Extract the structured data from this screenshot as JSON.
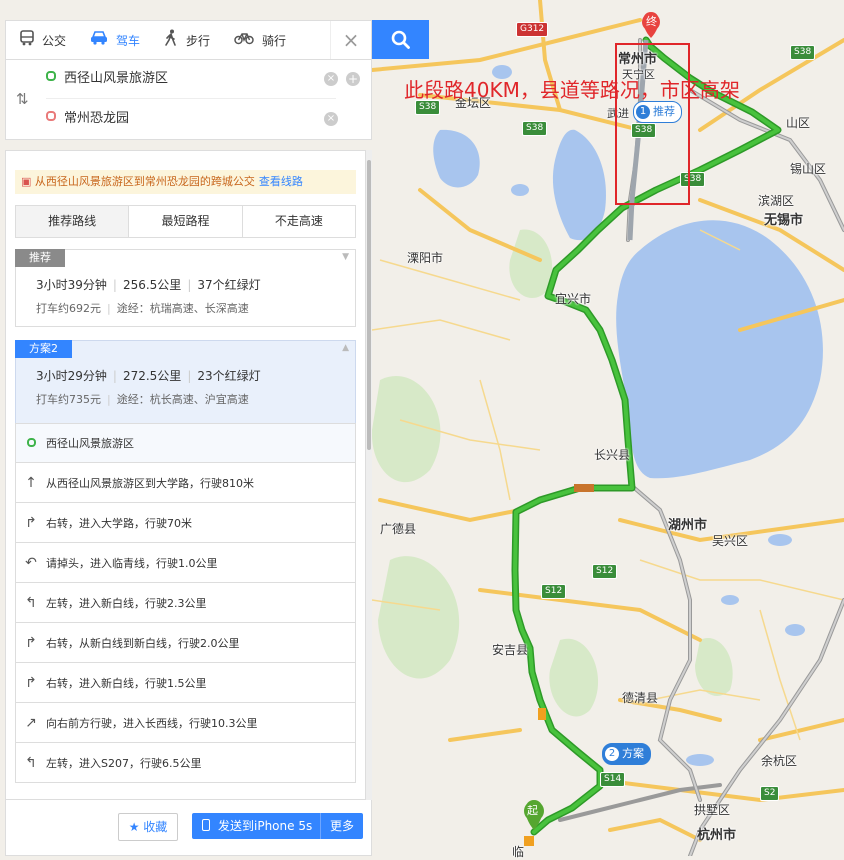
{
  "map": {
    "annotation": "此段路40KM，县道等路况，市区高架",
    "places": {
      "changzhou": "常州市",
      "tianning": "天宁区",
      "wujin": "武进",
      "jintan": "金坛区",
      "liyang": "溧阳市",
      "yixing": "宜兴市",
      "wuxi": "无锡市",
      "binhu": "滨湖区",
      "xishan": "锡山区",
      "changxing": "长兴县",
      "huzhou": "湖州市",
      "wuxing": "吴兴区",
      "guangde": "广德县",
      "anji": "安吉县",
      "deqing": "德清县",
      "yuhang": "余杭区",
      "gongshu": "拱墅区",
      "hangzhou": "杭州市",
      "shan": "山区",
      "lin": "临"
    },
    "roads": [
      "G312",
      "S38",
      "S38",
      "S38",
      "S38",
      "S12",
      "S12",
      "S14",
      "S2",
      "S38"
    ],
    "markers": {
      "end": "终",
      "start": "起",
      "recommend_num": "1",
      "recommend_label": "推荐",
      "plan_num": "2",
      "plan_label": "方案"
    },
    "colors": {
      "route": "#3cb332",
      "annotation": "#e0262a",
      "accent": "#3385ff"
    }
  },
  "panel": {
    "modes": [
      {
        "label": "公交",
        "icon": "bus-icon"
      },
      {
        "label": "驾车",
        "icon": "car-icon"
      },
      {
        "label": "步行",
        "icon": "walk-icon"
      },
      {
        "label": "骑行",
        "icon": "bike-icon"
      }
    ],
    "close": "×",
    "origin": "西径山风景旅游区",
    "destination": "常州恐龙园",
    "swap": "⇅",
    "clear": "×",
    "add": "+",
    "banner": {
      "text": "从西径山风景旅游区到常州恐龙园的跨城公交",
      "link": "查看线路"
    },
    "tabs": [
      "推荐路线",
      "最短路程",
      "不走高速"
    ],
    "routes": [
      {
        "tag": "推荐",
        "time": "3小时39分钟",
        "distance": "256.5公里",
        "lights": "37个红绿灯",
        "taxi": "打车约692元",
        "via": "途经：杭瑞高速、长深高速"
      },
      {
        "tag": "方案2",
        "time": "3小时29分钟",
        "distance": "272.5公里",
        "lights": "23个红绿灯",
        "taxi": "打车约735元",
        "via": "途经：杭长高速、沪宜高速"
      }
    ],
    "start_step": "西径山风景旅游区",
    "steps": [
      {
        "icon": "straight-arrow-icon",
        "glyph": "↑",
        "text": "从西径山风景旅游区到大学路，行驶810米"
      },
      {
        "icon": "turn-right-icon",
        "glyph": "↱",
        "text": "右转，进入大学路，行驶70米"
      },
      {
        "icon": "u-turn-icon",
        "glyph": "↶",
        "text": "请掉头，进入临青线，行驶1.0公里"
      },
      {
        "icon": "turn-left-icon",
        "glyph": "↰",
        "text": "左转，进入新白线，行驶2.3公里"
      },
      {
        "icon": "turn-right-icon",
        "glyph": "↱",
        "text": "右转，从新白线到新白线，行驶2.0公里"
      },
      {
        "icon": "turn-right-icon",
        "glyph": "↱",
        "text": "右转，进入新白线，行驶1.5公里"
      },
      {
        "icon": "bear-right-icon",
        "glyph": "↗",
        "text": "向右前方行驶，进入长西线，行驶10.3公里"
      },
      {
        "icon": "turn-left-icon",
        "glyph": "↰",
        "text": "左转，进入S207，行驶6.5公里"
      }
    ],
    "favorite": "收藏",
    "send": "发送到iPhone 5s",
    "more": "更多"
  }
}
